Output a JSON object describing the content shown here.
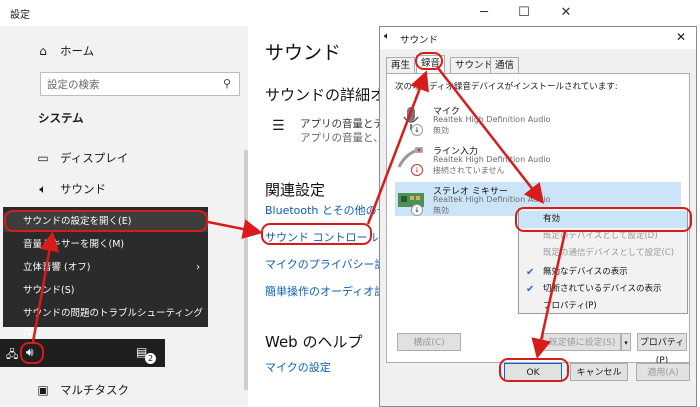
{
  "settings": {
    "title": "設定",
    "home": "ホーム",
    "search_placeholder": "設定の検索",
    "section": "システム",
    "nav": {
      "display": "ディスプレイ",
      "sound": "サウンド",
      "multitask": "マルチタスク"
    },
    "main": {
      "title": "サウンド",
      "advanced_heading": "サウンドの詳細オプシ",
      "app_volume_title": "アプリの音量とデバイ",
      "app_volume_sub": "アプリの音量と、使用",
      "related_heading": "関連設定",
      "related_links": [
        "Bluetooth とその他のデバイ",
        "サウンド コントロール パネル",
        "マイクのプライバシー設定",
        "簡単操作のオーディオ設定"
      ],
      "help_heading": "Web のヘルプ",
      "help_link": "マイクの設定"
    }
  },
  "context_menu": {
    "items": [
      "サウンドの設定を開く(E)",
      "音量ミキサーを開く(M)",
      "立体音響 (オフ)",
      "サウンド(S)",
      "サウンドの問題のトラブルシューティング(T)"
    ],
    "submenu_arrow": "›"
  },
  "taskbar": {
    "badge": "2"
  },
  "dialog": {
    "title": "サウンド",
    "tabs": [
      "再生",
      "録音",
      "サウンド",
      "通信"
    ],
    "instruction": "次のオーディオ録音デバイスがインストールされています:",
    "devices": [
      {
        "name": "マイク",
        "driver": "Realtek High Definition Audio",
        "status": "無効"
      },
      {
        "name": "ライン入力",
        "driver": "Realtek High Definition Audio",
        "status": "接続されていません"
      },
      {
        "name": "ステレオ ミキサー",
        "driver": "Realtek High Definition Audio",
        "status": "無効"
      }
    ],
    "buttons": {
      "configure": "構成(C)",
      "set_default": "既定値に設定(S)",
      "properties": "プロパティ(P)",
      "ok": "OK",
      "cancel": "キャンセル",
      "apply": "適用(A)"
    },
    "context_menu": {
      "items": [
        "有効",
        "既定のデバイスとして設定(D)",
        "既定の通信デバイスとして設定(C)",
        "無効なデバイスの表示",
        "切断されているデバイスの表示",
        "プロパティ(P)"
      ]
    }
  },
  "colors": {
    "annotation": "#d81c1c",
    "link": "#0a5ebd",
    "selection": "#cce4f7"
  }
}
